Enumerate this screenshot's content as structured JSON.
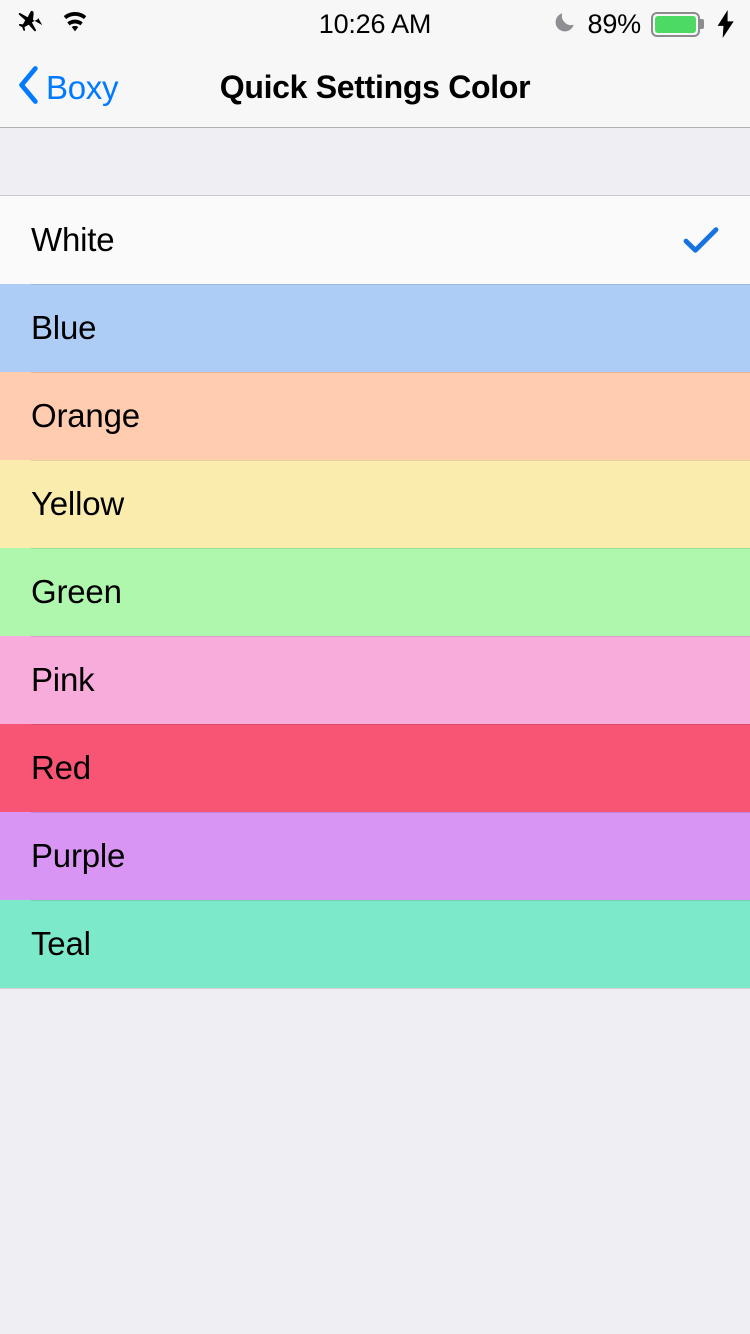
{
  "status_bar": {
    "airplane_icon": "airplane-mode-icon",
    "wifi_icon": "wifi-icon",
    "time": "10:26 AM",
    "do_not_disturb_icon": "moon-icon",
    "battery_percent": "89%",
    "battery_fill_color": "#4CD964",
    "charging_icon": "lightning-bolt-icon"
  },
  "nav_bar": {
    "back_icon": "chevron-left-icon",
    "back_label": "Boxy",
    "back_tint": "#007AFF",
    "title": "Quick Settings Color"
  },
  "list": {
    "selected": "White",
    "checkmark_color": "#1673E0",
    "rows": [
      {
        "label": "White",
        "bg": "#FAFAFA",
        "checked": true
      },
      {
        "label": "Blue",
        "bg": "#ADCDF7",
        "checked": false
      },
      {
        "label": "Orange",
        "bg": "#FFCCB0",
        "checked": false
      },
      {
        "label": "Yellow",
        "bg": "#FAECAC",
        "checked": false
      },
      {
        "label": "Green",
        "bg": "#AFF7AC",
        "checked": false
      },
      {
        "label": "Pink",
        "bg": "#F8ACDB",
        "checked": false
      },
      {
        "label": "Red",
        "bg": "#F85575",
        "checked": false
      },
      {
        "label": "Purple",
        "bg": "#D895F3",
        "checked": false
      },
      {
        "label": "Teal",
        "bg": "#7CEACA",
        "checked": false
      }
    ]
  },
  "background_color": "#EFEEF3"
}
